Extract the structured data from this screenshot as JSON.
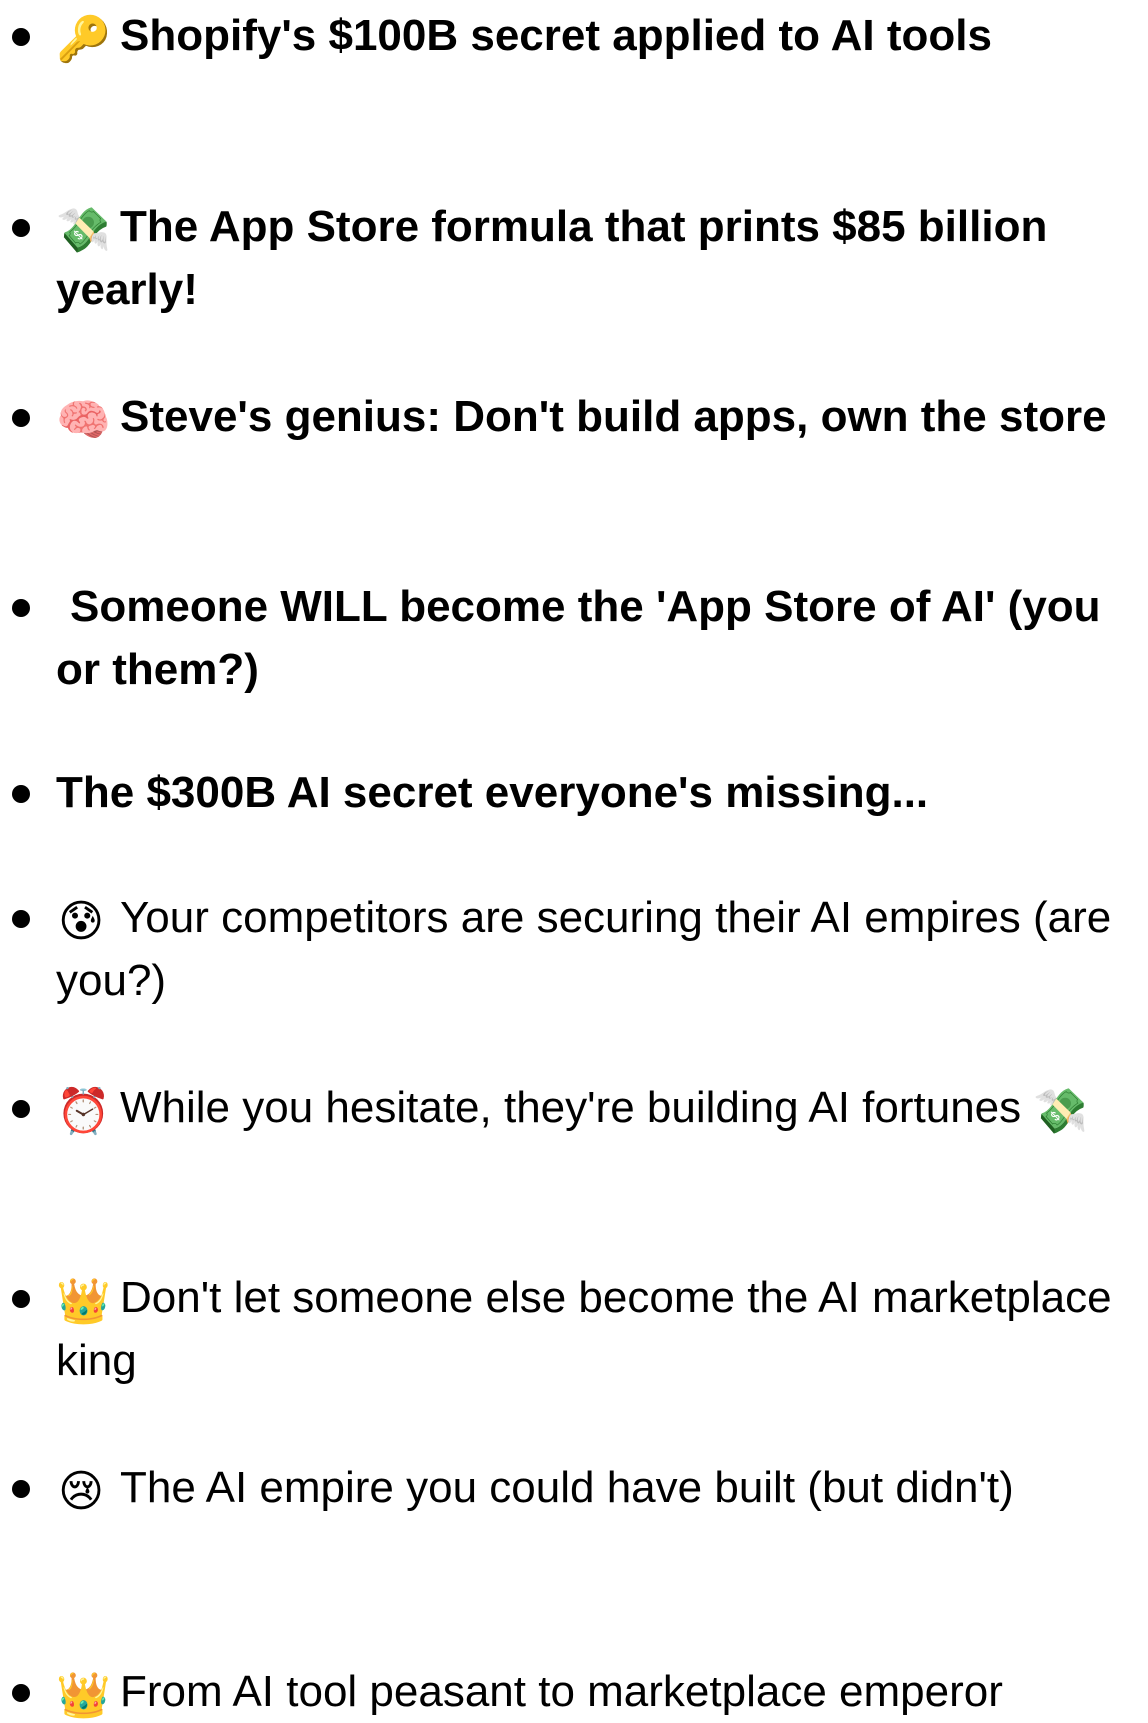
{
  "items": [
    {
      "icon": "key-icon",
      "glyph": "🔑",
      "text": "Shopify's $100B secret applied to AI tools",
      "bold": true
    },
    {
      "icon": "money-with-wings-icon",
      "glyph": "💸",
      "text": "The App Store formula that prints $85 billion yearly!",
      "bold": true
    },
    {
      "icon": "brain-icon",
      "glyph": "🧠",
      "text": "Steve's genius: Don't build apps, own the store",
      "bold": true
    },
    {
      "icon": "",
      "glyph": "",
      "text": "Someone WILL become the 'App Store of AI' (you or them?)",
      "bold": true
    },
    {
      "icon": "",
      "glyph": "",
      "text": "The $300B AI secret everyone's missing...",
      "bold": true
    },
    {
      "icon": "anxious-face-icon",
      "glyph": "😰",
      "text": "Your competitors are securing their AI empires (are you?)",
      "bold": false
    },
    {
      "icon": "alarm-clock-icon",
      "glyph": "⏰",
      "text": "While you hesitate, they're building AI fortunes",
      "bold": false,
      "trailing_icon": "money-with-wings-icon",
      "trailing_glyph": "💸"
    },
    {
      "icon": "crown-icon",
      "glyph": "👑",
      "text": "Don't let someone else become the AI marketplace king",
      "bold": false
    },
    {
      "icon": "crying-face-icon",
      "glyph": "😢",
      "text": "The AI empire you could have built (but didn't)",
      "bold": false
    },
    {
      "icon": "crown-icon",
      "glyph": "👑",
      "text": "From AI tool peasant to marketplace emperor",
      "bold": false
    }
  ]
}
